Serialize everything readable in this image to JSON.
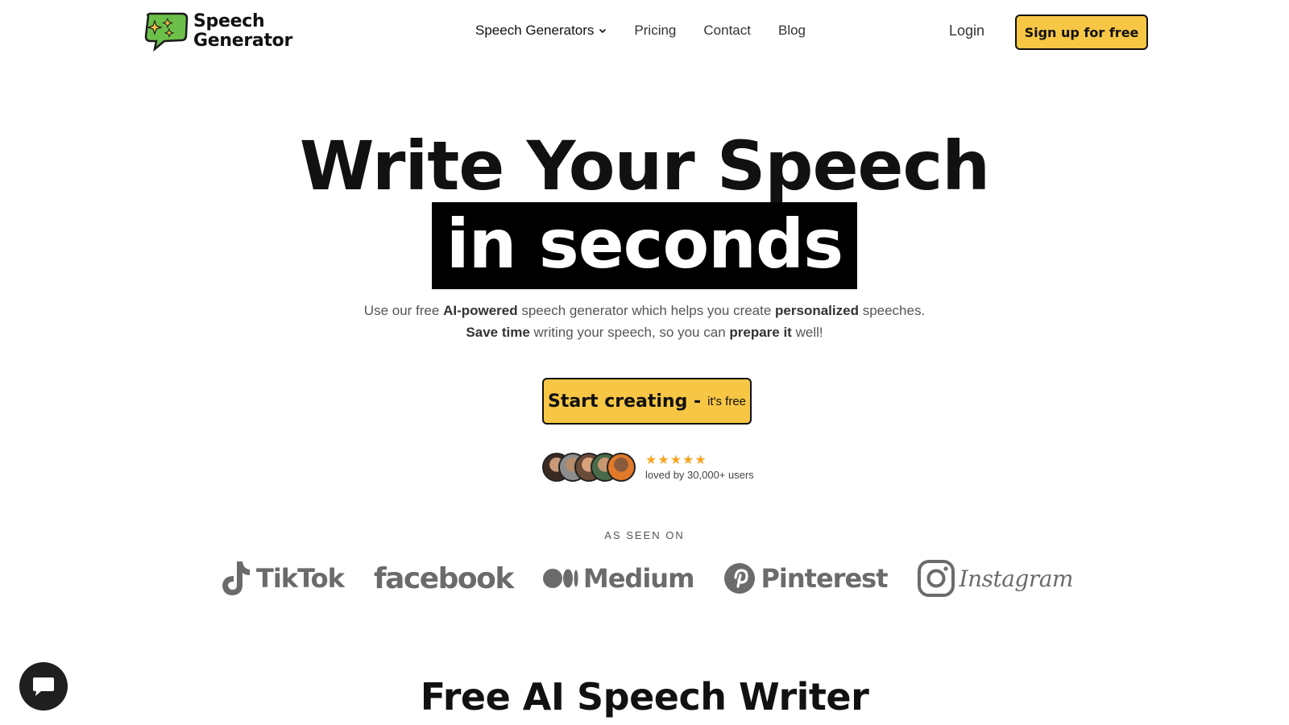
{
  "header": {
    "logo_line1": "Speech",
    "logo_line2": "Generator",
    "nav": {
      "generators": "Speech Generators",
      "pricing": "Pricing",
      "contact": "Contact",
      "blog": "Blog"
    },
    "login": "Login",
    "signup": "Sign up for free"
  },
  "hero": {
    "title_line1": "Write Your Speech",
    "title_line2": "in seconds",
    "sub1": {
      "t1": "Use our free ",
      "b1": "AI-powered",
      "t2": " speech generator which helps you create ",
      "b2": "personalized",
      "t3": " speeches."
    },
    "sub2": {
      "b1": "Save time",
      "t1": " writing your speech, so you can ",
      "b2": "prepare it",
      "t2": " well!"
    },
    "cta_main": "Start creating -",
    "cta_small": "it's free",
    "stars": "★★★★★",
    "loved": "loved by 30,000+ users"
  },
  "as_seen_on": {
    "label": "AS SEEN ON",
    "brands": [
      "TikTok",
      "facebook",
      "Medium",
      "Pinterest",
      "Instagram"
    ]
  },
  "section": {
    "title": "Free AI Speech Writer"
  },
  "colors": {
    "accent": "#f7c645",
    "logo_green": "#6cc04a",
    "star": "#f5a623"
  },
  "icons": [
    "speech-bubble-logo-icon",
    "chevron-down-icon",
    "tiktok-icon",
    "medium-icon",
    "pinterest-icon",
    "instagram-icon",
    "chat-icon"
  ]
}
